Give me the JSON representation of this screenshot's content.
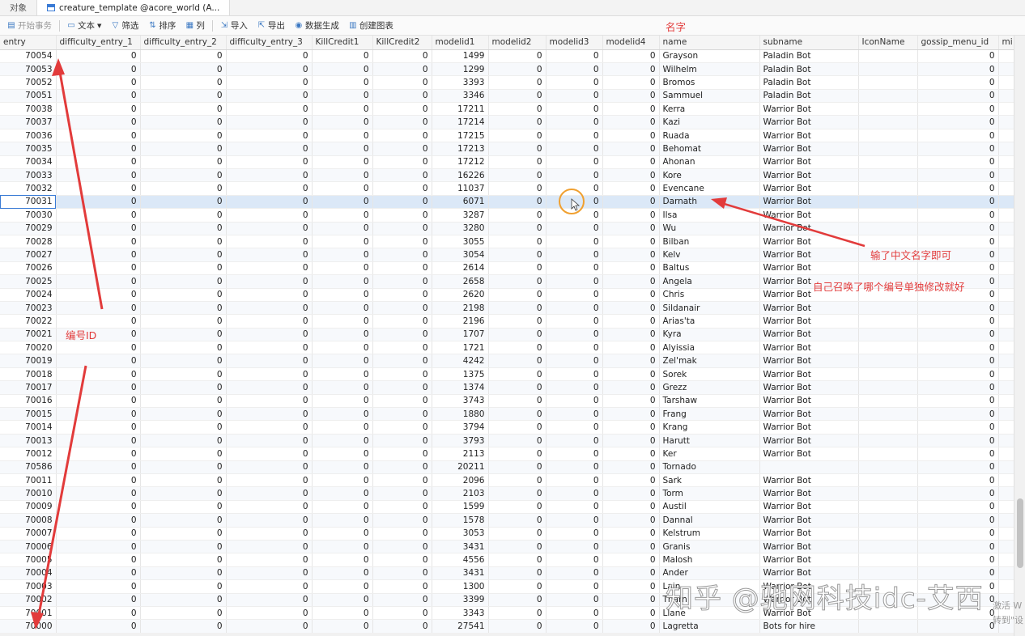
{
  "tabs": [
    {
      "label": "对象"
    },
    {
      "label": "creature_template @acore_world (A..."
    }
  ],
  "toolbar": {
    "begin_transaction": "开始事务",
    "text": "文本",
    "filter": "筛选",
    "sort": "排序",
    "columns": "列",
    "import": "导入",
    "export": "导出",
    "generate": "数据生成",
    "create_chart": "创建图表"
  },
  "grid": {
    "columns": [
      "entry",
      "difficulty_entry_1",
      "difficulty_entry_2",
      "difficulty_entry_3",
      "KillCredit1",
      "KillCredit2",
      "modelid1",
      "modelid2",
      "modelid3",
      "modelid4",
      "name",
      "subname",
      "IconName",
      "gossip_menu_id",
      "mi"
    ],
    "selected_entry": "70031",
    "rows": [
      [
        "70054",
        "0",
        "0",
        "0",
        "0",
        "0",
        "1499",
        "0",
        "0",
        "0",
        "Grayson",
        "Paladin Bot",
        "",
        "0"
      ],
      [
        "70053",
        "0",
        "0",
        "0",
        "0",
        "0",
        "1299",
        "0",
        "0",
        "0",
        "Wilhelm",
        "Paladin Bot",
        "",
        "0"
      ],
      [
        "70052",
        "0",
        "0",
        "0",
        "0",
        "0",
        "3393",
        "0",
        "0",
        "0",
        "Bromos",
        "Paladin Bot",
        "",
        "0"
      ],
      [
        "70051",
        "0",
        "0",
        "0",
        "0",
        "0",
        "3346",
        "0",
        "0",
        "0",
        "Sammuel",
        "Paladin Bot",
        "",
        "0"
      ],
      [
        "70038",
        "0",
        "0",
        "0",
        "0",
        "0",
        "17211",
        "0",
        "0",
        "0",
        "Kerra",
        "Warrior Bot",
        "",
        "0"
      ],
      [
        "70037",
        "0",
        "0",
        "0",
        "0",
        "0",
        "17214",
        "0",
        "0",
        "0",
        "Kazi",
        "Warrior Bot",
        "",
        "0"
      ],
      [
        "70036",
        "0",
        "0",
        "0",
        "0",
        "0",
        "17215",
        "0",
        "0",
        "0",
        "Ruada",
        "Warrior Bot",
        "",
        "0"
      ],
      [
        "70035",
        "0",
        "0",
        "0",
        "0",
        "0",
        "17213",
        "0",
        "0",
        "0",
        "Behomat",
        "Warrior Bot",
        "",
        "0"
      ],
      [
        "70034",
        "0",
        "0",
        "0",
        "0",
        "0",
        "17212",
        "0",
        "0",
        "0",
        "Ahonan",
        "Warrior Bot",
        "",
        "0"
      ],
      [
        "70033",
        "0",
        "0",
        "0",
        "0",
        "0",
        "16226",
        "0",
        "0",
        "0",
        "Kore",
        "Warrior Bot",
        "",
        "0"
      ],
      [
        "70032",
        "0",
        "0",
        "0",
        "0",
        "0",
        "11037",
        "0",
        "0",
        "0",
        "Evencane",
        "Warrior Bot",
        "",
        "0"
      ],
      [
        "70031",
        "0",
        "0",
        "0",
        "0",
        "0",
        "6071",
        "0",
        "0",
        "0",
        "Darnath",
        "Warrior Bot",
        "",
        "0"
      ],
      [
        "70030",
        "0",
        "0",
        "0",
        "0",
        "0",
        "3287",
        "0",
        "0",
        "0",
        "Ilsa",
        "Warrior Bot",
        "",
        "0"
      ],
      [
        "70029",
        "0",
        "0",
        "0",
        "0",
        "0",
        "3280",
        "0",
        "0",
        "0",
        "Wu",
        "Warrior Bot",
        "",
        "0"
      ],
      [
        "70028",
        "0",
        "0",
        "0",
        "0",
        "0",
        "3055",
        "0",
        "0",
        "0",
        "Bilban",
        "Warrior Bot",
        "",
        "0"
      ],
      [
        "70027",
        "0",
        "0",
        "0",
        "0",
        "0",
        "3054",
        "0",
        "0",
        "0",
        "Kelv",
        "Warrior Bot",
        "",
        "0"
      ],
      [
        "70026",
        "0",
        "0",
        "0",
        "0",
        "0",
        "2614",
        "0",
        "0",
        "0",
        "Baltus",
        "Warrior Bot",
        "",
        "0"
      ],
      [
        "70025",
        "0",
        "0",
        "0",
        "0",
        "0",
        "2658",
        "0",
        "0",
        "0",
        "Angela",
        "Warrior Bot",
        "",
        "0"
      ],
      [
        "70024",
        "0",
        "0",
        "0",
        "0",
        "0",
        "2620",
        "0",
        "0",
        "0",
        "Chris",
        "Warrior Bot",
        "",
        "0"
      ],
      [
        "70023",
        "0",
        "0",
        "0",
        "0",
        "0",
        "2198",
        "0",
        "0",
        "0",
        "Sildanair",
        "Warrior Bot",
        "",
        "0"
      ],
      [
        "70022",
        "0",
        "0",
        "0",
        "0",
        "0",
        "2196",
        "0",
        "0",
        "0",
        "Arias'ta",
        "Warrior Bot",
        "",
        "0"
      ],
      [
        "70021",
        "0",
        "0",
        "0",
        "0",
        "0",
        "1707",
        "0",
        "0",
        "0",
        "Kyra",
        "Warrior Bot",
        "",
        "0"
      ],
      [
        "70020",
        "0",
        "0",
        "0",
        "0",
        "0",
        "1721",
        "0",
        "0",
        "0",
        "Alyissia",
        "Warrior Bot",
        "",
        "0"
      ],
      [
        "70019",
        "0",
        "0",
        "0",
        "0",
        "0",
        "4242",
        "0",
        "0",
        "0",
        "Zel'mak",
        "Warrior Bot",
        "",
        "0"
      ],
      [
        "70018",
        "0",
        "0",
        "0",
        "0",
        "0",
        "1375",
        "0",
        "0",
        "0",
        "Sorek",
        "Warrior Bot",
        "",
        "0"
      ],
      [
        "70017",
        "0",
        "0",
        "0",
        "0",
        "0",
        "1374",
        "0",
        "0",
        "0",
        "Grezz",
        "Warrior Bot",
        "",
        "0"
      ],
      [
        "70016",
        "0",
        "0",
        "0",
        "0",
        "0",
        "3743",
        "0",
        "0",
        "0",
        "Tarshaw",
        "Warrior Bot",
        "",
        "0"
      ],
      [
        "70015",
        "0",
        "0",
        "0",
        "0",
        "0",
        "1880",
        "0",
        "0",
        "0",
        "Frang",
        "Warrior Bot",
        "",
        "0"
      ],
      [
        "70014",
        "0",
        "0",
        "0",
        "0",
        "0",
        "3794",
        "0",
        "0",
        "0",
        "Krang",
        "Warrior Bot",
        "",
        "0"
      ],
      [
        "70013",
        "0",
        "0",
        "0",
        "0",
        "0",
        "3793",
        "0",
        "0",
        "0",
        "Harutt",
        "Warrior Bot",
        "",
        "0"
      ],
      [
        "70012",
        "0",
        "0",
        "0",
        "0",
        "0",
        "2113",
        "0",
        "0",
        "0",
        "Ker",
        "Warrior Bot",
        "",
        "0"
      ],
      [
        "70586",
        "0",
        "0",
        "0",
        "0",
        "0",
        "20211",
        "0",
        "0",
        "0",
        "Tornado",
        "",
        "",
        "0"
      ],
      [
        "70011",
        "0",
        "0",
        "0",
        "0",
        "0",
        "2096",
        "0",
        "0",
        "0",
        "Sark",
        "Warrior Bot",
        "",
        "0"
      ],
      [
        "70010",
        "0",
        "0",
        "0",
        "0",
        "0",
        "2103",
        "0",
        "0",
        "0",
        "Torm",
        "Warrior Bot",
        "",
        "0"
      ],
      [
        "70009",
        "0",
        "0",
        "0",
        "0",
        "0",
        "1599",
        "0",
        "0",
        "0",
        "Austil",
        "Warrior Bot",
        "",
        "0"
      ],
      [
        "70008",
        "0",
        "0",
        "0",
        "0",
        "0",
        "1578",
        "0",
        "0",
        "0",
        "Dannal",
        "Warrior Bot",
        "",
        "0"
      ],
      [
        "70007",
        "0",
        "0",
        "0",
        "0",
        "0",
        "3053",
        "0",
        "0",
        "0",
        "Kelstrum",
        "Warrior Bot",
        "",
        "0"
      ],
      [
        "70006",
        "0",
        "0",
        "0",
        "0",
        "0",
        "3431",
        "0",
        "0",
        "0",
        "Granis",
        "Warrior Bot",
        "",
        "0"
      ],
      [
        "70005",
        "0",
        "0",
        "0",
        "0",
        "0",
        "4556",
        "0",
        "0",
        "0",
        "Malosh",
        "Warrior Bot",
        "",
        "0"
      ],
      [
        "70004",
        "0",
        "0",
        "0",
        "0",
        "0",
        "3431",
        "0",
        "0",
        "0",
        "Ander",
        "Warrior Bot",
        "",
        "0"
      ],
      [
        "70003",
        "0",
        "0",
        "0",
        "0",
        "0",
        "1300",
        "0",
        "0",
        "0",
        "Lain",
        "Warrior Bot",
        "",
        "0"
      ],
      [
        "70002",
        "0",
        "0",
        "0",
        "0",
        "0",
        "3399",
        "0",
        "0",
        "0",
        "Tharn",
        "Warrior Bot",
        "",
        "0"
      ],
      [
        "70001",
        "0",
        "0",
        "0",
        "0",
        "0",
        "3343",
        "0",
        "0",
        "0",
        "Llane",
        "Warrior Bot",
        "",
        "0"
      ],
      [
        "70000",
        "0",
        "0",
        "0",
        "0",
        "0",
        "27541",
        "0",
        "0",
        "0",
        "Lagretta",
        "Bots for hire",
        "",
        "0"
      ]
    ]
  },
  "annotations": {
    "name_label": "名字",
    "id_label": "编号ID",
    "hint1": "输了中文名字即可",
    "hint2": "自己召唤了哪个编号单独修改就好",
    "color": "#e23b3b"
  },
  "watermark": "知乎 @驰网科技idc-艾西",
  "windows_activation": [
    "激活 W",
    "转到\"设"
  ]
}
